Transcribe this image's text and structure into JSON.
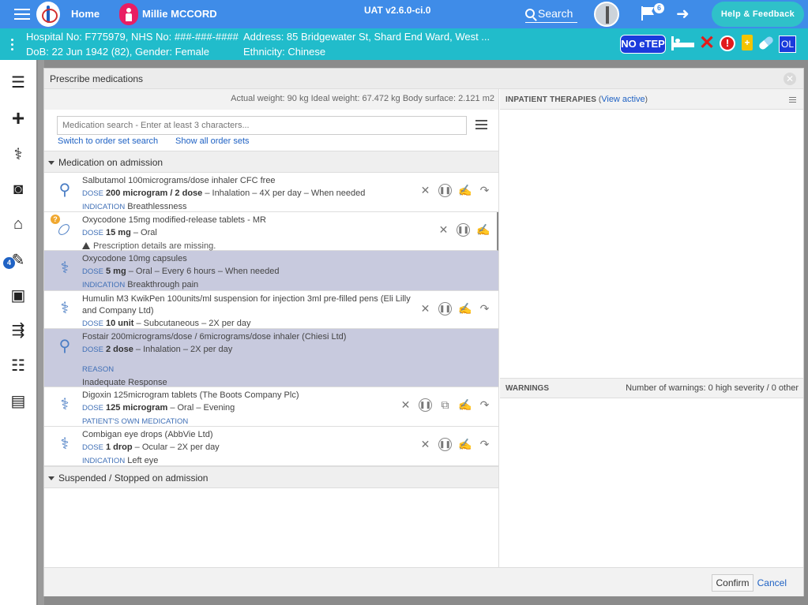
{
  "topbar": {
    "home_label": "Home",
    "patient_name": "Millie MCCORD",
    "environment": "UAT v2.6.0-ci.0",
    "search_label": "Search",
    "flag_count": "6",
    "help_label": "Help & Feedback"
  },
  "banner": {
    "line1": "Hospital No: F775979, NHS No: ###-###-####",
    "line2": "DoB: 22 Jun 1942 (82), Gender: Female",
    "address": "Address: 85 Bridgewater St, Shard End Ward, West ...",
    "ethnicity": "Ethnicity: Chinese",
    "noetep": "NO eTEP",
    "ol": "OL"
  },
  "sidenav": {
    "badge": "4"
  },
  "modal": {
    "title": "Prescribe medications",
    "weights": "Actual weight: 90 kg    Ideal weight: 67.472 kg    Body surface: 2.121 m2",
    "search_placeholder": "Medication search - Enter at least 3 characters...",
    "link_order_set": "Switch to order set search",
    "link_show_all": "Show all order sets",
    "section_admission": "Medication on admission",
    "section_suspended": "Suspended / Stopped on admission",
    "confirm": "Confirm",
    "cancel": "Cancel"
  },
  "meds": [
    {
      "name": "Salbutamol 100micrograms/dose inhaler CFC free",
      "dose_key": "DOSE",
      "dose": "200 microgram / 2 dose",
      "route": " – Inhalation – 4X per day – When needed",
      "extra_key": "INDICATION",
      "extra": " Breathlessness"
    },
    {
      "name": "Oxycodone 15mg modified-release tablets - MR",
      "dose_key": "DOSE",
      "dose": "15 mg",
      "route": " – Oral",
      "missing": "Prescription details are missing."
    },
    {
      "name": "Oxycodone 10mg capsules",
      "dose_key": "DOSE",
      "dose": "5 mg",
      "route": " – Oral – Every 6 hours – When needed",
      "extra_key": "INDICATION",
      "extra": " Breakthrough pain"
    },
    {
      "name": "Humulin M3 KwikPen 100units/ml suspension for injection 3ml pre-filled pens (Eli Lilly and Company Ltd)",
      "dose_key": "DOSE",
      "dose": "10 unit",
      "route": " – Subcutaneous – 2X per day"
    },
    {
      "name": "Fostair 200micrograms/dose / 6micrograms/dose inhaler (Chiesi Ltd)",
      "dose_key": "DOSE",
      "dose": "2 dose",
      "route": " – Inhalation – 2X per day",
      "reason_key": "REASON",
      "reason": "Inadequate Response"
    },
    {
      "name": "Digoxin 125microgram tablets (The Boots Company Plc)",
      "dose_key": "DOSE",
      "dose": "125 microgram",
      "route": " – Oral – Evening",
      "extra_key": "PATIENT'S OWN MEDICATION",
      "extra": ""
    },
    {
      "name": "Combigan eye drops (AbbVie Ltd)",
      "dose_key": "DOSE",
      "dose": "1 drop",
      "route": " – Ocular – 2X per day",
      "extra_key": "INDICATION",
      "extra": " Left eye"
    }
  ],
  "right": {
    "therapies_title": "INPATIENT THERAPIES",
    "view_active": "View active",
    "warnings_title": "WARNINGS",
    "warnings_count": "Number of warnings: 0 high severity / 0 other"
  }
}
